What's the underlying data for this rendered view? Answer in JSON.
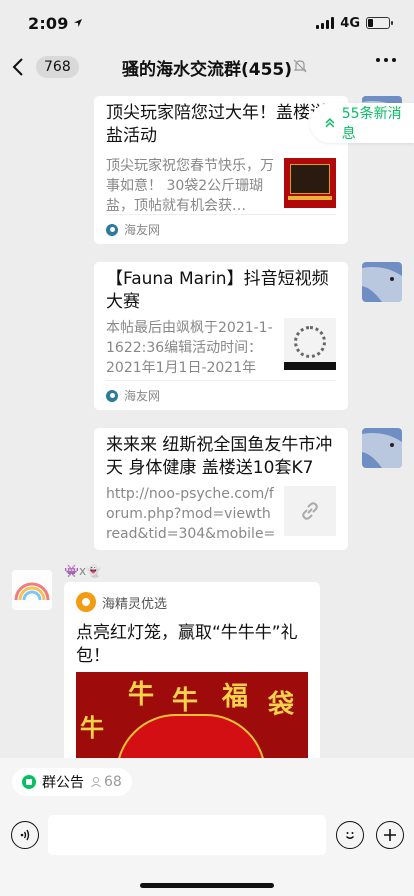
{
  "status_bar": {
    "time": "2:09",
    "network": "4G",
    "battery_level": 0.25
  },
  "nav": {
    "unread_count": "768",
    "title": "骚的海水交流群(455)"
  },
  "new_messages": {
    "label": "55条新消息"
  },
  "messages": [
    {
      "title": "顶尖玩家陪您过大年！盖楼送盐活动",
      "desc": "顶尖玩家祝您春节快乐，万事如意！ 30袋2公斤珊瑚盐，顶帖就有机会获…",
      "source": "海友网"
    },
    {
      "title": "【Fauna Marin】抖音短视频大赛",
      "desc": "本帖最后由飒枫于2021-1-1622:36编辑活动时间：2021年1月1日-2021年2…",
      "source": "海友网"
    },
    {
      "title": "来来来 纽斯祝全国鱼友牛市冲天 身体健康 盖楼送10套K7 -…",
      "desc": "http://noo-psyche.com/forum.php?mod=viewthread&tid=304&mobile=2"
    }
  ],
  "sender": {
    "name": "👾x👻"
  },
  "mini_program": {
    "source": "海精灵优选",
    "title": "点亮红灯笼，赢取“牛牛牛”礼包！",
    "banner_chars": [
      "牛",
      "牛",
      "福",
      "袋",
      "牛"
    ]
  },
  "group_notice": {
    "label": "群公告",
    "count": "68"
  }
}
